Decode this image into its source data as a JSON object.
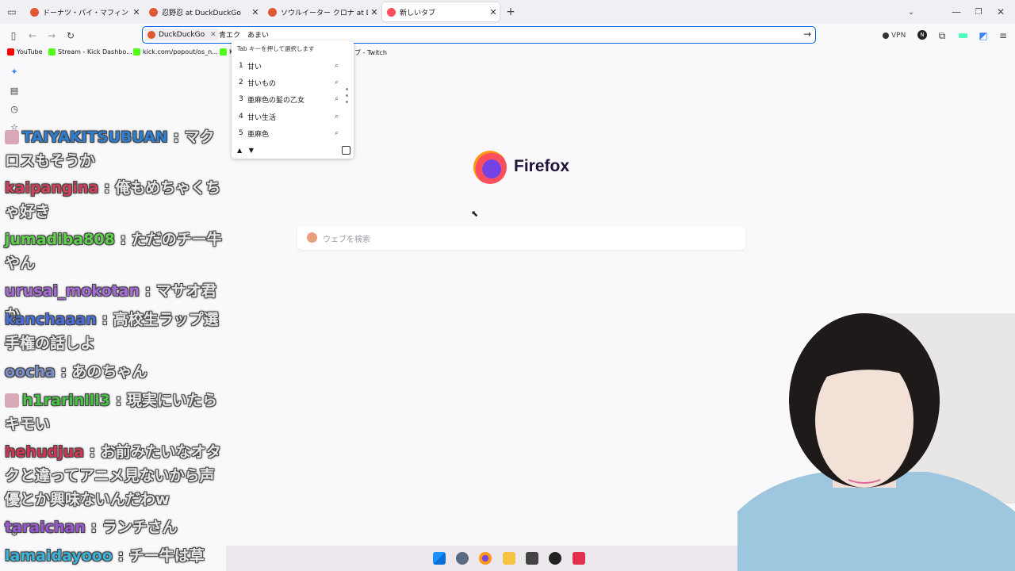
{
  "tabs": [
    {
      "title": "ドーナツ・パイ・マフィン｜メニュー｜ミ",
      "favicon_color": "#de5833",
      "active": false
    },
    {
      "title": "忍野忍 at DuckDuckGo",
      "favicon_color": "#de5833",
      "active": false
    },
    {
      "title": "ソウルイーター クロナ at DuckDu",
      "favicon_color": "#de5833",
      "active": false
    },
    {
      "title": "新しいタブ",
      "favicon_color": "#ff4f5e",
      "active": true
    }
  ],
  "toolbar": {
    "engine_chip": "DuckDuckGo",
    "url_text": "青エク　あまい",
    "vpn_label": "VPN",
    "profile_letter": "N"
  },
  "bookmarks": [
    {
      "label": "YouTube",
      "icon_color": "#ff0000"
    },
    {
      "label": "Stream - Kick Dashbo...",
      "icon_color": "#53fc18"
    },
    {
      "label": "kick.com/popout/os_n...",
      "icon_color": "#53fc18"
    },
    {
      "label": "K",
      "icon_color": "#53fc18"
    },
    {
      "label": "ブ - Twitch",
      "icon_color": ""
    }
  ],
  "suggest": {
    "hint": "Tab キーを押して選択します",
    "items": [
      {
        "num": "1",
        "text": "甘い"
      },
      {
        "num": "2",
        "text": "甘いもの"
      },
      {
        "num": "3",
        "text": "亜麻色の髪の乙女"
      },
      {
        "num": "4",
        "text": "甘い生活"
      },
      {
        "num": "5",
        "text": "亜麻色"
      }
    ],
    "up_arrow": "▲",
    "down_arrow": "▼"
  },
  "newtab": {
    "brand": "Firefox",
    "search_placeholder": "ウェブを検索"
  },
  "chat": [
    {
      "user": "TAIYAKITSUBUAN",
      "color": "#2d7fd3",
      "text": "マクロスもそうか",
      "badge": true
    },
    {
      "user": "kaipangina",
      "color": "#d0405a",
      "text": "俺もめちゃくちゃ好き",
      "badge": false
    },
    {
      "user": "jumadiba808",
      "color": "#5ed04c",
      "text": "ただのチー牛やん",
      "badge": false
    },
    {
      "user": "urusai_mokotan",
      "color": "#a86ad6",
      "text": "マサオ君か",
      "badge": false
    },
    {
      "user": "kanchaaan",
      "color": "#4a6fd9",
      "text": "高校生ラップ選手権の話しよ",
      "badge": false
    },
    {
      "user": "oocha",
      "color": "#7a8fc9",
      "text": "あのちゃん",
      "badge": false
    },
    {
      "user": "h1rarinlll3",
      "color": "#46c246",
      "text": "現実にいたらキモい",
      "badge": true
    },
    {
      "user": "hehudjua",
      "color": "#d03553",
      "text": "お前みたいなオタクと違ってアニメ見ないから声優とか興味ないんだわw",
      "badge": false
    },
    {
      "user": "taraichan",
      "color": "#9b56d4",
      "text": "ランチさん",
      "badge": false
    },
    {
      "user": "lamaidayooo",
      "color": "#3ab4d9",
      "text": "チー牛は草",
      "badge": false
    }
  ]
}
